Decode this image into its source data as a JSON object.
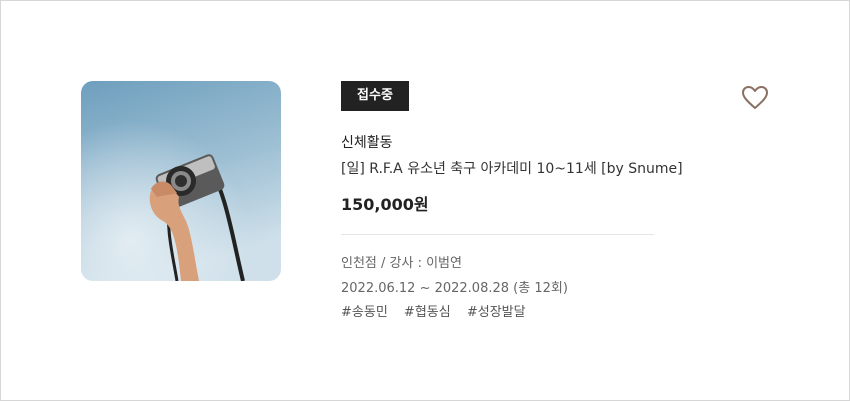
{
  "status_badge": "접수중",
  "category": "신체활동",
  "title": "[일] R.F.A 유소년 축구 아카데미 10~11세 [by Snume]",
  "price": "150,000원",
  "branch_instructor": "인천점 / 강사 : 이범연",
  "schedule": "2022.06.12 ~ 2022.08.28 (총 12회)",
  "tags": [
    "#송동민",
    "#협동심",
    "#성장발달"
  ],
  "icons": {
    "wishlist": "heart-outline-icon"
  },
  "colors": {
    "badge_bg": "#222222",
    "heart": "#8a7060"
  }
}
